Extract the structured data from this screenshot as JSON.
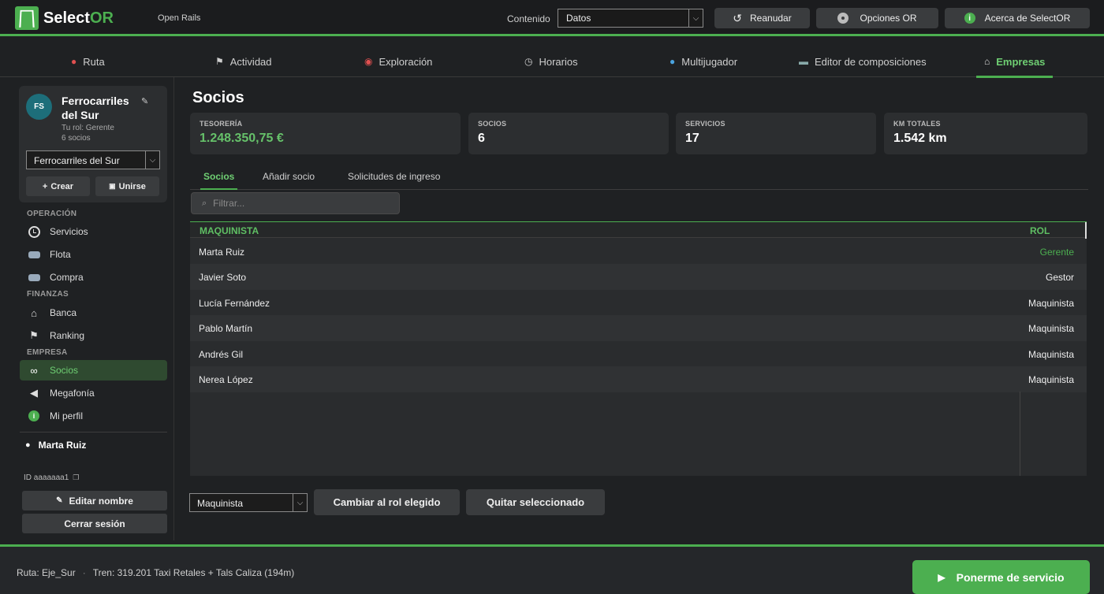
{
  "app": {
    "name_prefix": "Select",
    "name_suffix": "OR",
    "subtitle": "Open Rails",
    "accent": "#4caf50"
  },
  "header": {
    "content_label": "Contenido",
    "content_value": "Datos",
    "buttons": [
      {
        "label": "Reanudar",
        "icon": "resume-icon"
      },
      {
        "label": "Opciones OR",
        "icon": "disc-icon"
      },
      {
        "label": "Acerca de SelectOR",
        "icon": "info-icon"
      }
    ]
  },
  "nav": {
    "tabs": [
      {
        "label": "Ruta",
        "icon": "pin-icon"
      },
      {
        "label": "Actividad",
        "icon": "flag-icon"
      },
      {
        "label": "Exploración",
        "icon": "explore-icon"
      },
      {
        "label": "Horarios",
        "icon": "clock-icon"
      },
      {
        "label": "Multijugador",
        "icon": "globe-icon"
      },
      {
        "label": "Editor de composiciones",
        "icon": "train-icon"
      },
      {
        "label": "Empresas",
        "icon": "bank-icon"
      }
    ],
    "active": "Empresas"
  },
  "sidebar": {
    "company": {
      "initials": "FS",
      "name": "Ferrocarriles del Sur",
      "role": "Tu rol: Gerente",
      "members": "6 socios",
      "selected": "Ferrocarriles del Sur",
      "create_label": "Crear",
      "join_label": "Unirse"
    },
    "sections": {
      "operacion": "OPERACIÓN",
      "finanzas": "FINANZAS",
      "empresa": "EMPRESA"
    },
    "items": [
      {
        "label": "Servicios",
        "icon": "clock-icon"
      },
      {
        "label": "Flota",
        "icon": "bus-icon"
      },
      {
        "label": "Compra",
        "icon": "bus-icon"
      },
      {
        "label": "Banca",
        "icon": "bank-icon"
      },
      {
        "label": "Ranking",
        "icon": "flag-icon"
      },
      {
        "label": "Socios",
        "icon": "link-icon"
      },
      {
        "label": "Megafonía",
        "icon": "speaker-icon"
      },
      {
        "label": "Mi perfil",
        "icon": "info-icon"
      }
    ],
    "active": "Socios",
    "user": {
      "name": "Marta Ruiz",
      "id": "ID aaaaaaa1"
    },
    "edit_name_label": "Editar nombre",
    "logout_label": "Cerrar sesión"
  },
  "main": {
    "title": "Socios",
    "stats": [
      {
        "label": "TESORERÍA",
        "value": "1.248.350,75 €"
      },
      {
        "label": "SOCIOS",
        "value": "6"
      },
      {
        "label": "SERVICIOS",
        "value": "17"
      },
      {
        "label": "KM TOTALES",
        "value": "1.542 km"
      }
    ],
    "subtabs": [
      "Socios",
      "Añadir socio",
      "Solicitudes de ingreso"
    ],
    "active_subtab": "Socios",
    "filter_placeholder": "Filtrar...",
    "table": {
      "columns": [
        "MAQUINISTA",
        "ROL"
      ],
      "rows": [
        {
          "name": "Marta Ruiz",
          "role": "Gerente"
        },
        {
          "name": "Javier Soto",
          "role": "Gestor"
        },
        {
          "name": "Lucía Fernández",
          "role": "Maquinista"
        },
        {
          "name": "Pablo Martín",
          "role": "Maquinista"
        },
        {
          "name": "Andrés Gil",
          "role": "Maquinista"
        },
        {
          "name": "Nerea López",
          "role": "Maquinista"
        }
      ]
    },
    "role_select": "Maquinista",
    "change_role_label": "Cambiar al rol elegido",
    "remove_label": "Quitar seleccionado"
  },
  "footer": {
    "route": "Ruta: Eje_Sur",
    "train": "Tren: 319.201 Taxi Retales + Tals Caliza (194m)",
    "primary_label": "Ponerme de servicio"
  }
}
